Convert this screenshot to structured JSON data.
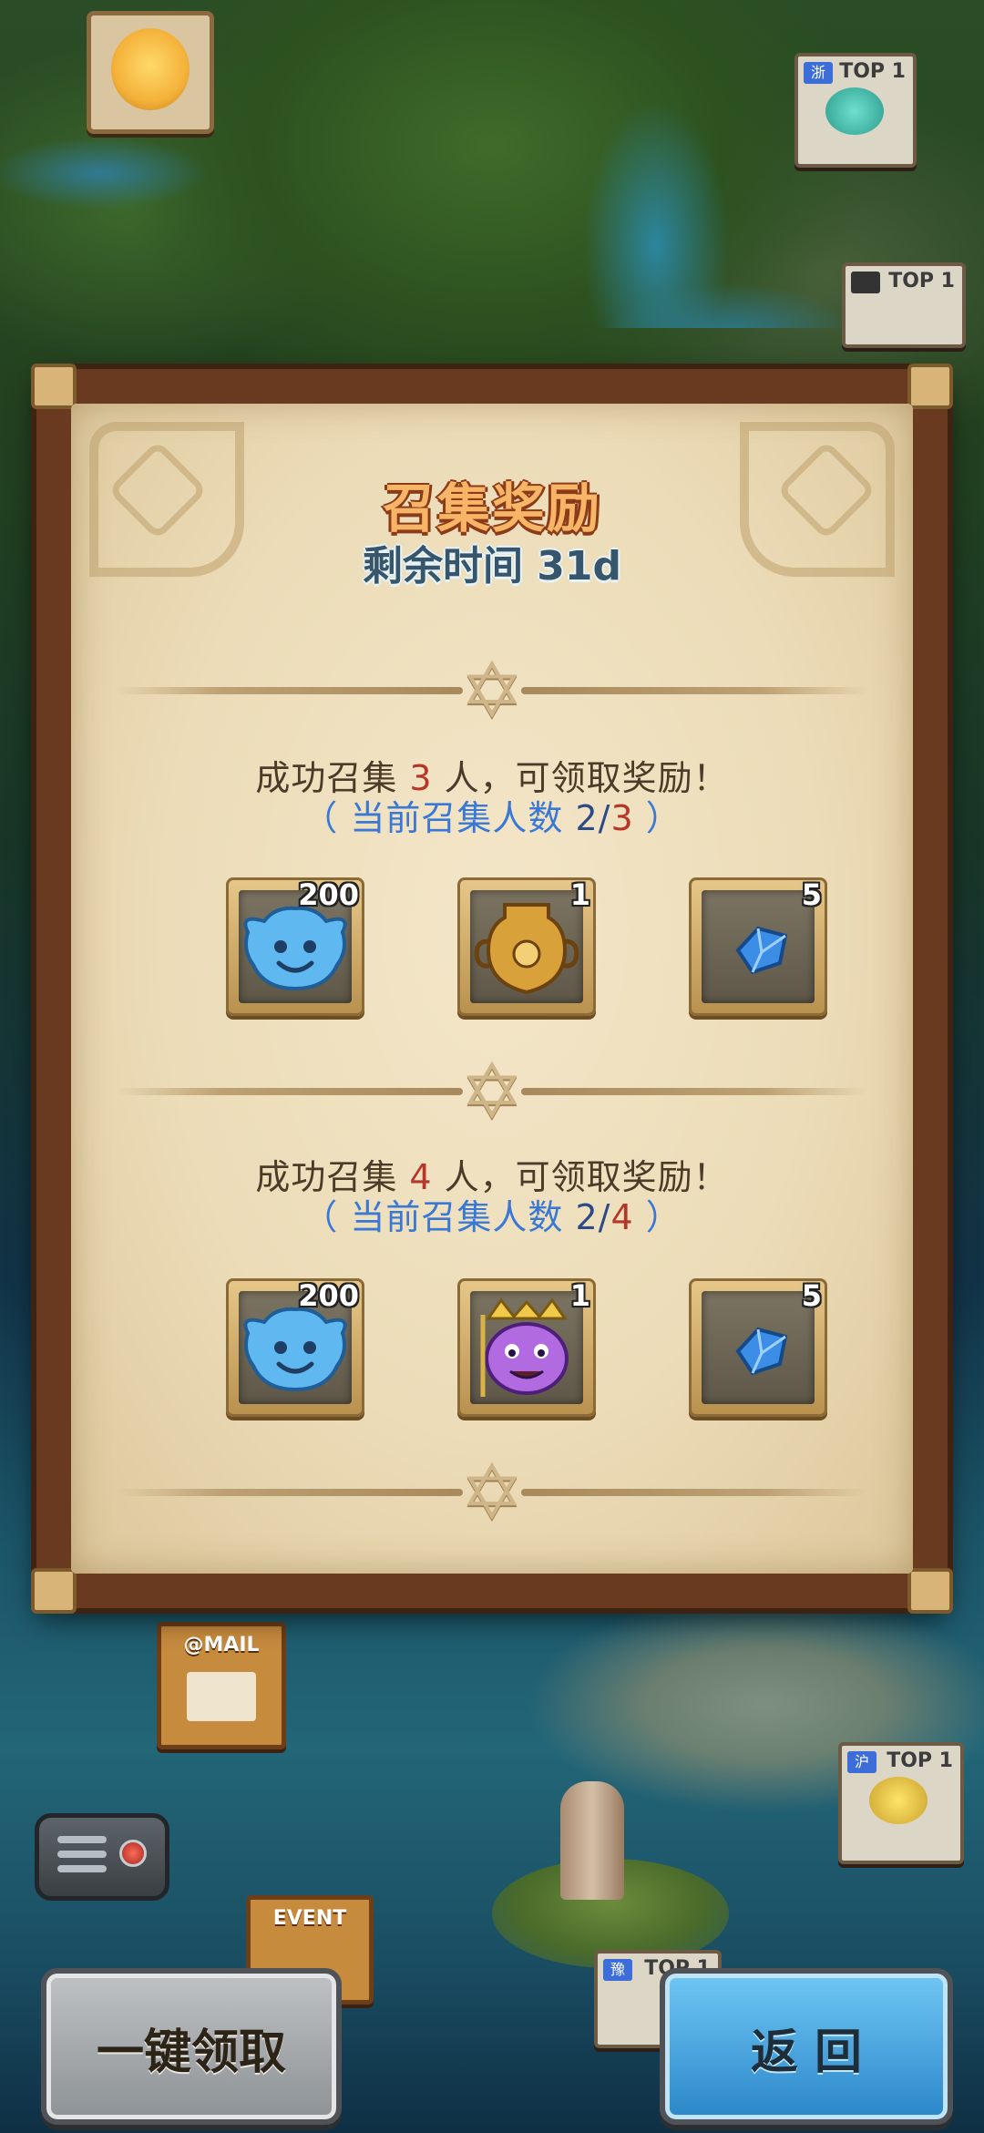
{
  "dialog": {
    "title": "召集奖励",
    "subtitle": "剩余时间 31d"
  },
  "tiers": [
    {
      "line1_prefix": "成功召集 ",
      "target": "3",
      "line1_suffix": " 人，可领取奖励！",
      "line2_prefix": "（ 当前召集人数 ",
      "current": "2/",
      "total": "3",
      "line2_suffix": " ）",
      "rewards": [
        {
          "icon": "blue-spirit-icon",
          "count": "200"
        },
        {
          "icon": "golden-urn-icon",
          "count": "1"
        },
        {
          "icon": "blue-crystal-icon",
          "count": "5"
        }
      ]
    },
    {
      "line1_prefix": "成功召集 ",
      "target": "4",
      "line1_suffix": " 人，可领取奖励！",
      "line2_prefix": "（ 当前召集人数 ",
      "current": "2/",
      "total": "4",
      "line2_suffix": " ）",
      "rewards": [
        {
          "icon": "blue-spirit-icon",
          "count": "200"
        },
        {
          "icon": "purple-monster-icon",
          "count": "1"
        },
        {
          "icon": "blue-crystal-icon",
          "count": "5"
        }
      ]
    }
  ],
  "buttons": {
    "claim_all": "一键领取",
    "back": "返 回"
  },
  "map": {
    "mail_label": "@MAIL",
    "event_label": "EVENT",
    "top_badges": [
      {
        "flag": "浙",
        "text": "TOP 1"
      },
      {
        "flag": "",
        "text": "TOP 1"
      },
      {
        "flag": "沪",
        "text": "TOP 1"
      },
      {
        "flag": "豫",
        "text": "TOP 1"
      }
    ]
  },
  "colors": {
    "title": "#f7b567",
    "highlight_red": "#b5372a",
    "progress_blue": "#3a78d6",
    "claim_button": "#a5a9ad",
    "back_button": "#4aa6e0"
  }
}
